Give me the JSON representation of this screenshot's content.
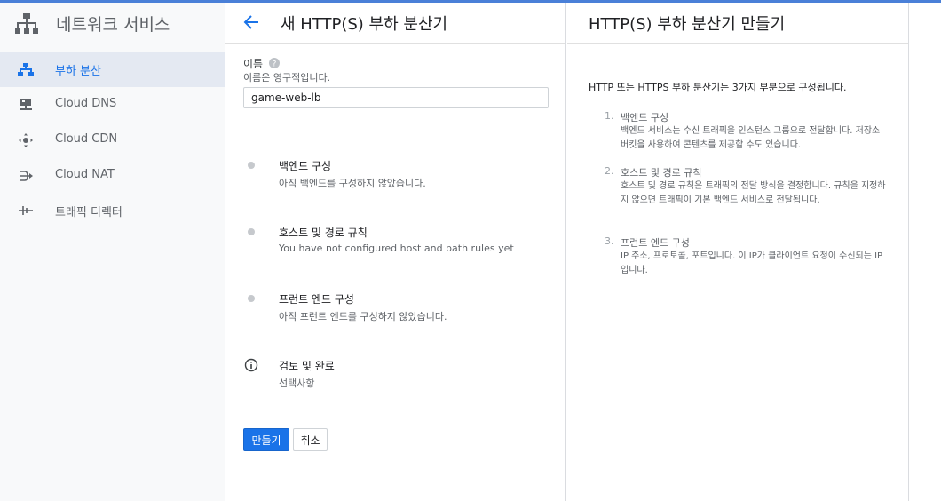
{
  "sidebar": {
    "title": "네트워크 서비스",
    "items": [
      {
        "label": "부하 분산",
        "icon": "load-balancer-icon",
        "active": true
      },
      {
        "label": "Cloud DNS",
        "icon": "dns-icon"
      },
      {
        "label": "Cloud CDN",
        "icon": "cdn-icon"
      },
      {
        "label": "Cloud NAT",
        "icon": "nat-icon"
      },
      {
        "label": "트래픽 디렉터",
        "icon": "traffic-director-icon"
      }
    ]
  },
  "main": {
    "title": "새 HTTP(S) 부하 분산기",
    "name_label": "이름",
    "name_hint": "이름은 영구적입니다.",
    "name_value": "game-web-lb",
    "steps": [
      {
        "title": "백엔드 구성",
        "desc": "아직 백엔드를 구성하지 않았습니다."
      },
      {
        "title": "호스트 및 경로 규칙",
        "desc": "You have not configured host and path rules yet"
      },
      {
        "title": "프런트 엔드 구성",
        "desc": "아직 프런트 엔드를 구성하지 않았습니다."
      },
      {
        "title": "검토 및 완료",
        "desc": "선택사항"
      }
    ],
    "create_label": "만들기",
    "cancel_label": "취소"
  },
  "help": {
    "title": "HTTP(S) 부하 분산기 만들기",
    "intro": "HTTP 또는 HTTPS 부하 분산기는 3가지 부분으로 구성됩니다.",
    "items": [
      {
        "num": "1.",
        "heading": "백엔드 구성",
        "desc": "백엔드 서비스는 수신 트래픽을 인스턴스 그룹으로 전달합니다. 저장소 버킷을 사용하여 콘텐츠를 제공할 수도 있습니다."
      },
      {
        "num": "2.",
        "heading": "호스트 및 경로 규칙",
        "desc": "호스트 및 경로 규칙은 트래픽의 전달 방식을 결정합니다. 규칙을 지정하지 않으면 트래픽이 기본 백엔드 서비스로 전달됩니다."
      },
      {
        "num": "3.",
        "heading": "프런트 엔드 구성",
        "desc": "IP 주소, 프로토콜, 포트입니다. 이 IP가 클라이언트 요청이 수신되는 IP입니다."
      }
    ]
  },
  "colors": {
    "accent": "#1a73e8",
    "active_bg": "#e4e9f2",
    "top_bar": "#4a80d8"
  }
}
